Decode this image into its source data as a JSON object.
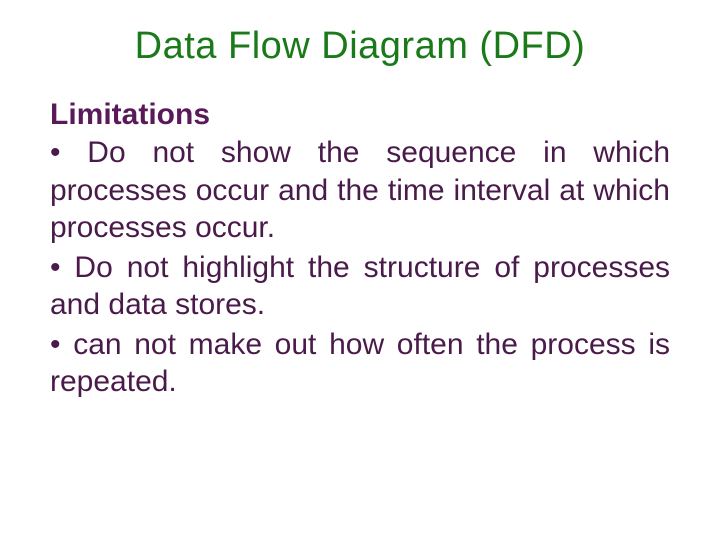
{
  "title": "Data Flow Diagram (DFD)",
  "section_heading": "Limitations",
  "bullets": {
    "item0": "• Do not show the sequence in which processes occur and the time interval at which processes occur.",
    "item1": "• Do not highlight the structure of processes and data stores.",
    "item2": "• can not make out how often the process is repeated."
  }
}
